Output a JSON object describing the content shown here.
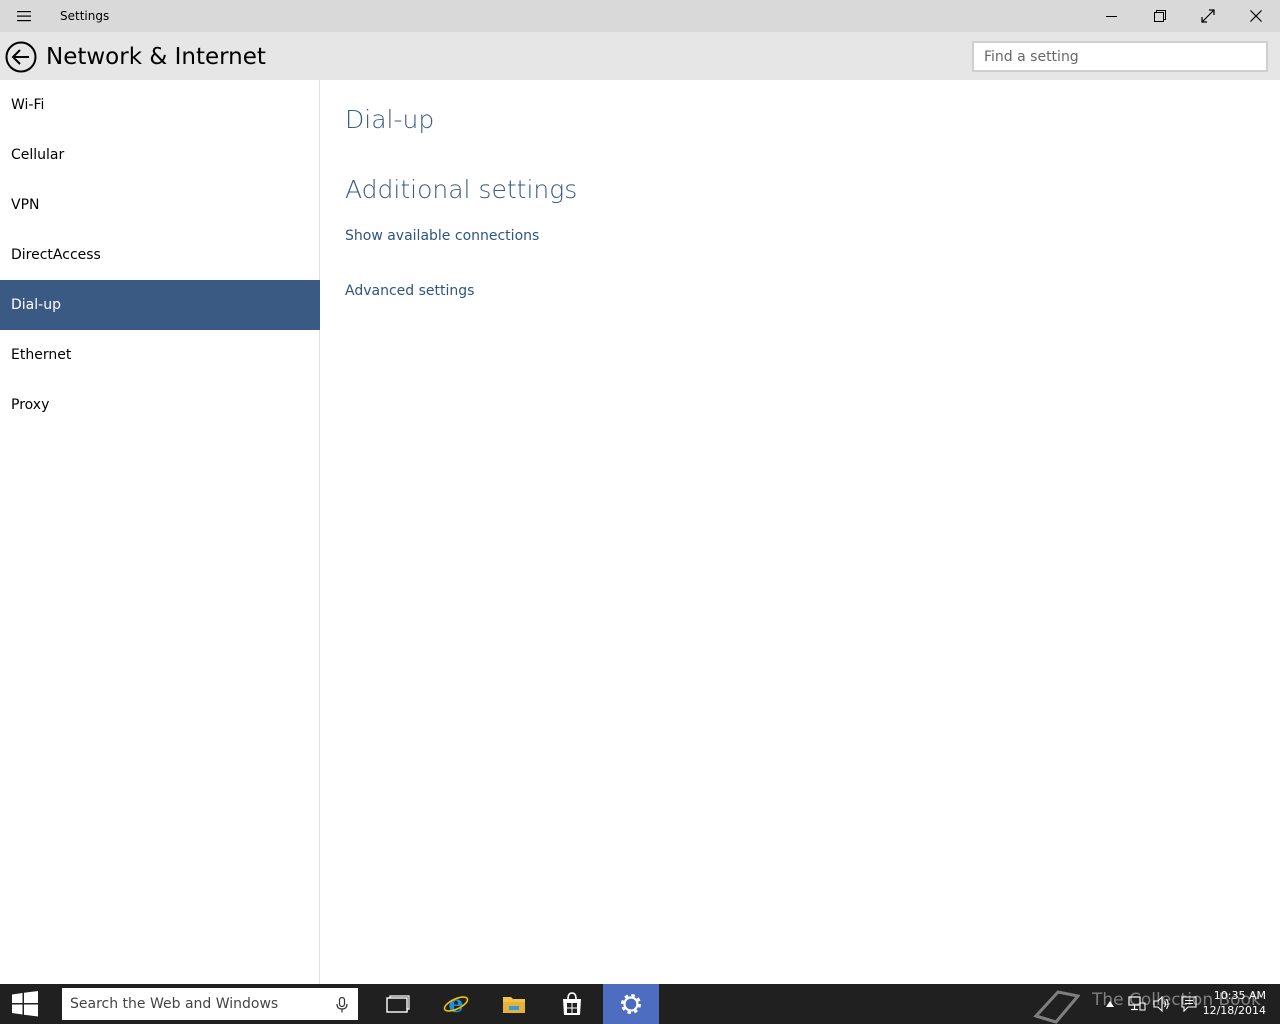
{
  "titlebar": {
    "app_title": "Settings",
    "icons": [
      "hamburger-icon",
      "minimize-icon",
      "restore-icon",
      "fullscreen-icon",
      "close-icon"
    ]
  },
  "header": {
    "title": "Network & Internet",
    "search_placeholder": "Find a setting"
  },
  "sidebar": {
    "items": [
      {
        "label": "Wi-Fi"
      },
      {
        "label": "Cellular"
      },
      {
        "label": "VPN"
      },
      {
        "label": "DirectAccess"
      },
      {
        "label": "Dial-up",
        "active": true
      },
      {
        "label": "Ethernet"
      },
      {
        "label": "Proxy"
      }
    ]
  },
  "content": {
    "heading": "Dial-up",
    "additional_heading": "Additional settings",
    "link_show_connections": "Show available connections",
    "link_advanced": "Advanced settings"
  },
  "taskbar": {
    "search_placeholder": "Search the Web and Windows",
    "apps": [
      "task-view-icon",
      "internet-explorer-icon",
      "file-explorer-icon",
      "store-icon",
      "settings-icon"
    ],
    "time": "10:35 AM",
    "date": "12/18/2014",
    "watermark_text": "The Collection Book"
  },
  "colors": {
    "accent": "#3a5a84",
    "link": "#2f5480",
    "titlebar": "#d9d9d9",
    "header": "#e6e6e6",
    "taskbar": "#202020",
    "taskbar_active": "#4d6ec0"
  }
}
